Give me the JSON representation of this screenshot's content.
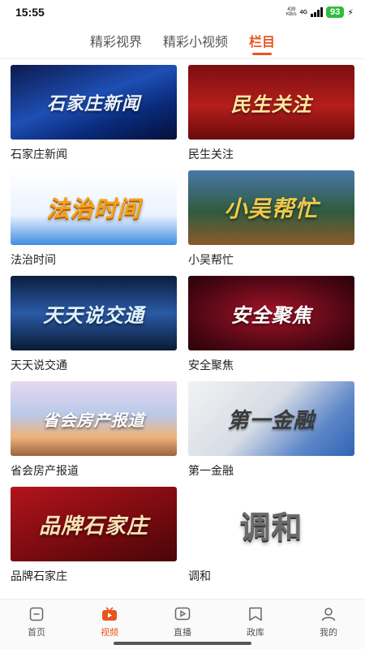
{
  "status_bar": {
    "time": "15:55",
    "net_speed_value": "439",
    "net_speed_unit": "KB/s",
    "network": "4G",
    "battery": "93"
  },
  "tabs": [
    {
      "label": "精彩视界",
      "active": false
    },
    {
      "label": "精彩小视频",
      "active": false
    },
    {
      "label": "栏目",
      "active": true
    }
  ],
  "programs": [
    {
      "title": "石家庄新闻",
      "thumb_text": "石家庄新闻"
    },
    {
      "title": "民生关注",
      "thumb_text": "民生关注"
    },
    {
      "title": "法治时间",
      "thumb_text": "法治时间"
    },
    {
      "title": "小吴帮忙",
      "thumb_text": "小吴帮忙"
    },
    {
      "title": "天天说交通",
      "thumb_text": "天天说交通"
    },
    {
      "title": "安全聚焦",
      "thumb_text": "安全聚焦"
    },
    {
      "title": "省会房产报道",
      "thumb_text": "省会房产报道"
    },
    {
      "title": "第一金融",
      "thumb_text": "第一金融"
    },
    {
      "title": "品牌石家庄",
      "thumb_text": "品牌石家庄"
    },
    {
      "title": "调和",
      "thumb_text": "调和"
    }
  ],
  "bottom_nav": [
    {
      "label": "首页",
      "icon": "home-icon",
      "active": false
    },
    {
      "label": "视频",
      "icon": "video-tv-icon",
      "active": true
    },
    {
      "label": "直播",
      "icon": "live-play-icon",
      "active": false
    },
    {
      "label": "政库",
      "icon": "bookmark-icon",
      "active": false
    },
    {
      "label": "我的",
      "icon": "user-icon",
      "active": false
    }
  ],
  "colors": {
    "accent": "#e8561e",
    "inactive": "#555555"
  }
}
